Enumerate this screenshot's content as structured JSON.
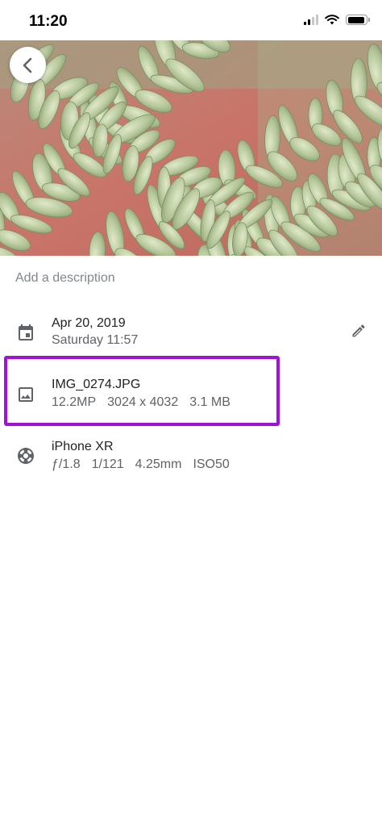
{
  "status_bar": {
    "time": "11:20",
    "icons": [
      "signal-icon",
      "wifi-icon",
      "battery-icon"
    ]
  },
  "photo": {
    "icon": "photo-preview"
  },
  "back_button": {
    "icon": "chevron-left-icon"
  },
  "description_placeholder": "Add a description",
  "date_row": {
    "icon": "calendar-icon",
    "date": "Apr 20, 2019",
    "day_time": "Saturday 11:57",
    "edit_icon": "pencil-icon"
  },
  "file_row": {
    "icon": "image-icon",
    "filename": "IMG_0274.JPG",
    "megapixels": "12.2MP",
    "resolution": "3024 x 4032",
    "size": "3.1 MB"
  },
  "camera_row": {
    "icon": "shutter-icon",
    "device": "iPhone XR",
    "aperture": "ƒ/1.8",
    "shutter": "1/121",
    "focal_length": "4.25mm",
    "iso": "ISO50"
  },
  "colors": {
    "highlight": "#a012d4",
    "primary_text": "#202124",
    "secondary_text": "#5f6368",
    "placeholder_text": "#80868b"
  }
}
